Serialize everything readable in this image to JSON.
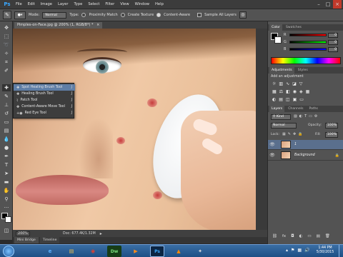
{
  "app": {
    "logo": "Ps",
    "doc_tab": "Pimples-on-Face.jpg @ 200% (1, RGB/8*) *",
    "close_glyph": "×"
  },
  "menu": [
    "File",
    "Edit",
    "Image",
    "Layer",
    "Type",
    "Select",
    "Filter",
    "View",
    "Window",
    "Help"
  ],
  "window_controls": [
    "–",
    "□",
    "×"
  ],
  "options_bar": {
    "mode_label": "Mode:",
    "mode_value": "Normal",
    "type_label": "Type:",
    "type_options": [
      "Proximity Match",
      "Create Texture",
      "Content-Aware"
    ],
    "sample_all_layers": "Sample All Layers"
  },
  "tool_flyout": [
    {
      "label": "Spot Healing Brush Tool",
      "key": "J"
    },
    {
      "label": "Healing Brush Tool",
      "key": "J"
    },
    {
      "label": "Patch Tool",
      "key": "J"
    },
    {
      "label": "Content-Aware Move Tool",
      "key": "J"
    },
    {
      "label": "Red Eye Tool",
      "key": "J"
    }
  ],
  "status": {
    "zoom": "200%",
    "doc_info": "Doc: 677.4K/1.32M"
  },
  "bottom_tabs": [
    "Mini Bridge",
    "Timeline"
  ],
  "color_panel": {
    "tabs": [
      "Color",
      "Swatches"
    ],
    "channels": [
      {
        "label": "R",
        "value": "0",
        "color": "#e03030"
      },
      {
        "label": "G",
        "value": "0",
        "color": "#30b030"
      },
      {
        "label": "B",
        "value": "0",
        "color": "#3050e0"
      }
    ]
  },
  "adjustments_panel": {
    "tabs": [
      "Adjustments",
      "Styles"
    ],
    "hint": "Add an adjustment"
  },
  "layers_panel": {
    "tabs": [
      "Layers",
      "Channels",
      "Paths"
    ],
    "kind_label": "Kind",
    "blend_mode": "Normal",
    "opacity_label": "Opacity:",
    "opacity_value": "100%",
    "lock_label": "Lock:",
    "fill_label": "Fill:",
    "fill_value": "100%",
    "layers": [
      {
        "name": "1"
      },
      {
        "name": "Background"
      }
    ]
  },
  "taskbar": {
    "time": "1:44 PM",
    "date": "5/30/2015",
    "pinned": [
      {
        "name": "ie",
        "glyph": "e"
      },
      {
        "name": "explorer",
        "glyph": "▤"
      },
      {
        "name": "chrome",
        "glyph": "◉"
      },
      {
        "name": "dreamweaver",
        "glyph": "Dw"
      },
      {
        "name": "mediaplayer",
        "glyph": "▶"
      },
      {
        "name": "photoshop",
        "glyph": "Ps"
      },
      {
        "name": "vlc",
        "glyph": "▲"
      },
      {
        "name": "other",
        "glyph": "✦"
      }
    ]
  }
}
